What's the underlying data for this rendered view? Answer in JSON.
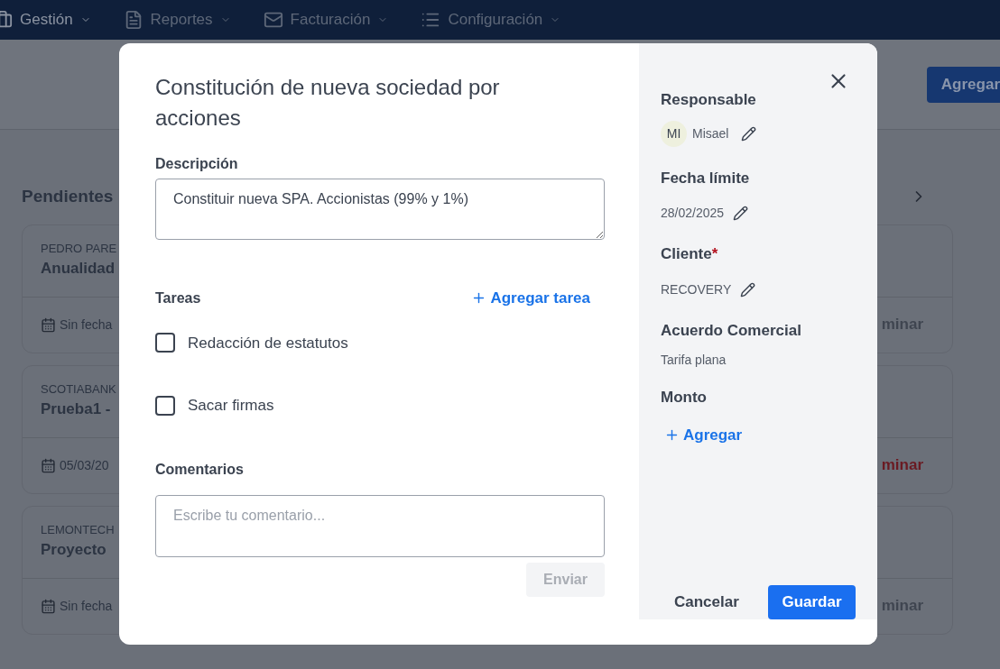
{
  "nav": [
    {
      "label": "Gestión"
    },
    {
      "label": "Reportes"
    },
    {
      "label": "Facturación"
    },
    {
      "label": "Configuración"
    }
  ],
  "header": {
    "add_button": "Agregar"
  },
  "section": {
    "title": "Pendientes"
  },
  "cards": [
    {
      "client": "PEDRO PARE",
      "title": "Anualidad",
      "date": "Sin fecha",
      "action": "minar",
      "kind": "muted"
    },
    {
      "client": "SCOTIABANK",
      "title": "Prueba1 -",
      "date": "05/03/20",
      "action": "minar",
      "kind": "danger"
    },
    {
      "client": "LEMONTECH",
      "title": "Proyecto",
      "date": "Sin fecha",
      "action": "minar",
      "kind": "muted"
    }
  ],
  "modal": {
    "title": "Constitución de nueva sociedad por acciones",
    "description": {
      "label": "Descripción",
      "value": "Constituir nueva SPA. Accionistas (99% y 1%)"
    },
    "tasks": {
      "label": "Tareas",
      "add": "Agregar tarea",
      "items": [
        {
          "label": "Redacción de estatutos",
          "checked": false
        },
        {
          "label": "Sacar firmas",
          "checked": false
        }
      ]
    },
    "comments": {
      "label": "Comentarios",
      "placeholder": "Escribe tu comentario...",
      "send": "Enviar",
      "send_disabled": true
    },
    "side": {
      "responsable": {
        "label": "Responsable",
        "initials": "MI",
        "name": "Misael"
      },
      "deadline": {
        "label": "Fecha límite",
        "value": "28/02/2025"
      },
      "client": {
        "label": "Cliente",
        "required_mark": "*",
        "value": "RECOVERY"
      },
      "agreement": {
        "label": "Acuerdo Comercial",
        "value": "Tarifa plana"
      },
      "amount": {
        "label": "Monto",
        "add": "Agregar"
      }
    },
    "cancel": "Cancelar",
    "save": "Guardar"
  }
}
